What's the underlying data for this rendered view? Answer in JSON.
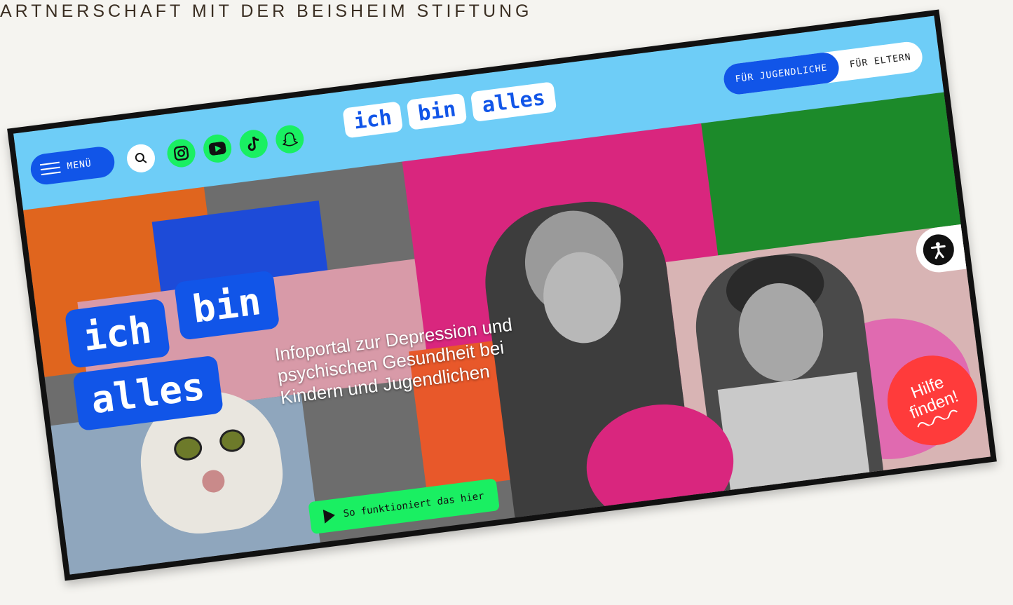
{
  "caption": "ARTNERSCHAFT MIT DER BEISHEIM STIFTUNG",
  "header": {
    "menu_label": "MENÜ",
    "logo_words": [
      "ich",
      "bin",
      "alles"
    ],
    "audience_toggle": {
      "active": "FÜR JUGENDLICHE",
      "inactive": "FÜR ELTERN"
    },
    "social_icons": [
      "instagram-icon",
      "youtube-icon",
      "tiktok-icon",
      "snapchat-icon"
    ]
  },
  "hero": {
    "logo_line1": [
      "ich",
      "bin"
    ],
    "logo_line2": "alles",
    "subtitle": "Infoportal zur Depression und psychischen Gesundheit bei Kindern und Jugendlichen",
    "cta_label": "So funktioniert das hier",
    "help_line1": "Hilfe",
    "help_line2": "finden!"
  },
  "colors": {
    "accent_blue": "#1155e8",
    "header_bg": "#6ecdf7",
    "green": "#1aef62",
    "help_red": "#ff3b3b",
    "magenta": "#d9267e"
  }
}
